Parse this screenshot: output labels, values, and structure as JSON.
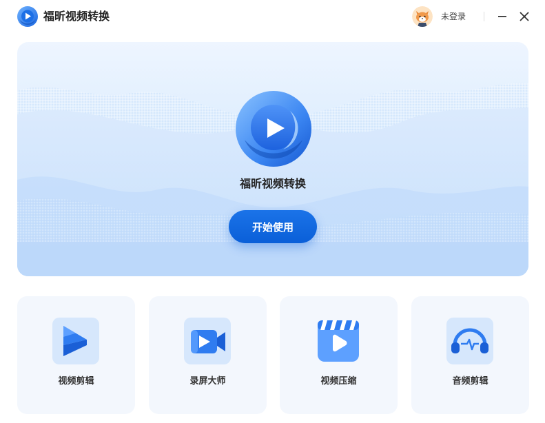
{
  "app": {
    "title": "福昕视频转换"
  },
  "header": {
    "login_text": "未登录"
  },
  "hero": {
    "title": "福昕视频转换",
    "start_button": "开始使用"
  },
  "tools": [
    {
      "label": "视频剪辑",
      "icon": "video-edit-icon"
    },
    {
      "label": "录屏大师",
      "icon": "screen-record-icon"
    },
    {
      "label": "视频压缩",
      "icon": "video-compress-icon"
    },
    {
      "label": "音频剪辑",
      "icon": "audio-edit-icon"
    }
  ],
  "colors": {
    "brand": "#1b73e8",
    "accent_dark": "#0a5fd8",
    "card_bg": "#f3f7fd",
    "icon_tile": "#d6e7fc"
  }
}
